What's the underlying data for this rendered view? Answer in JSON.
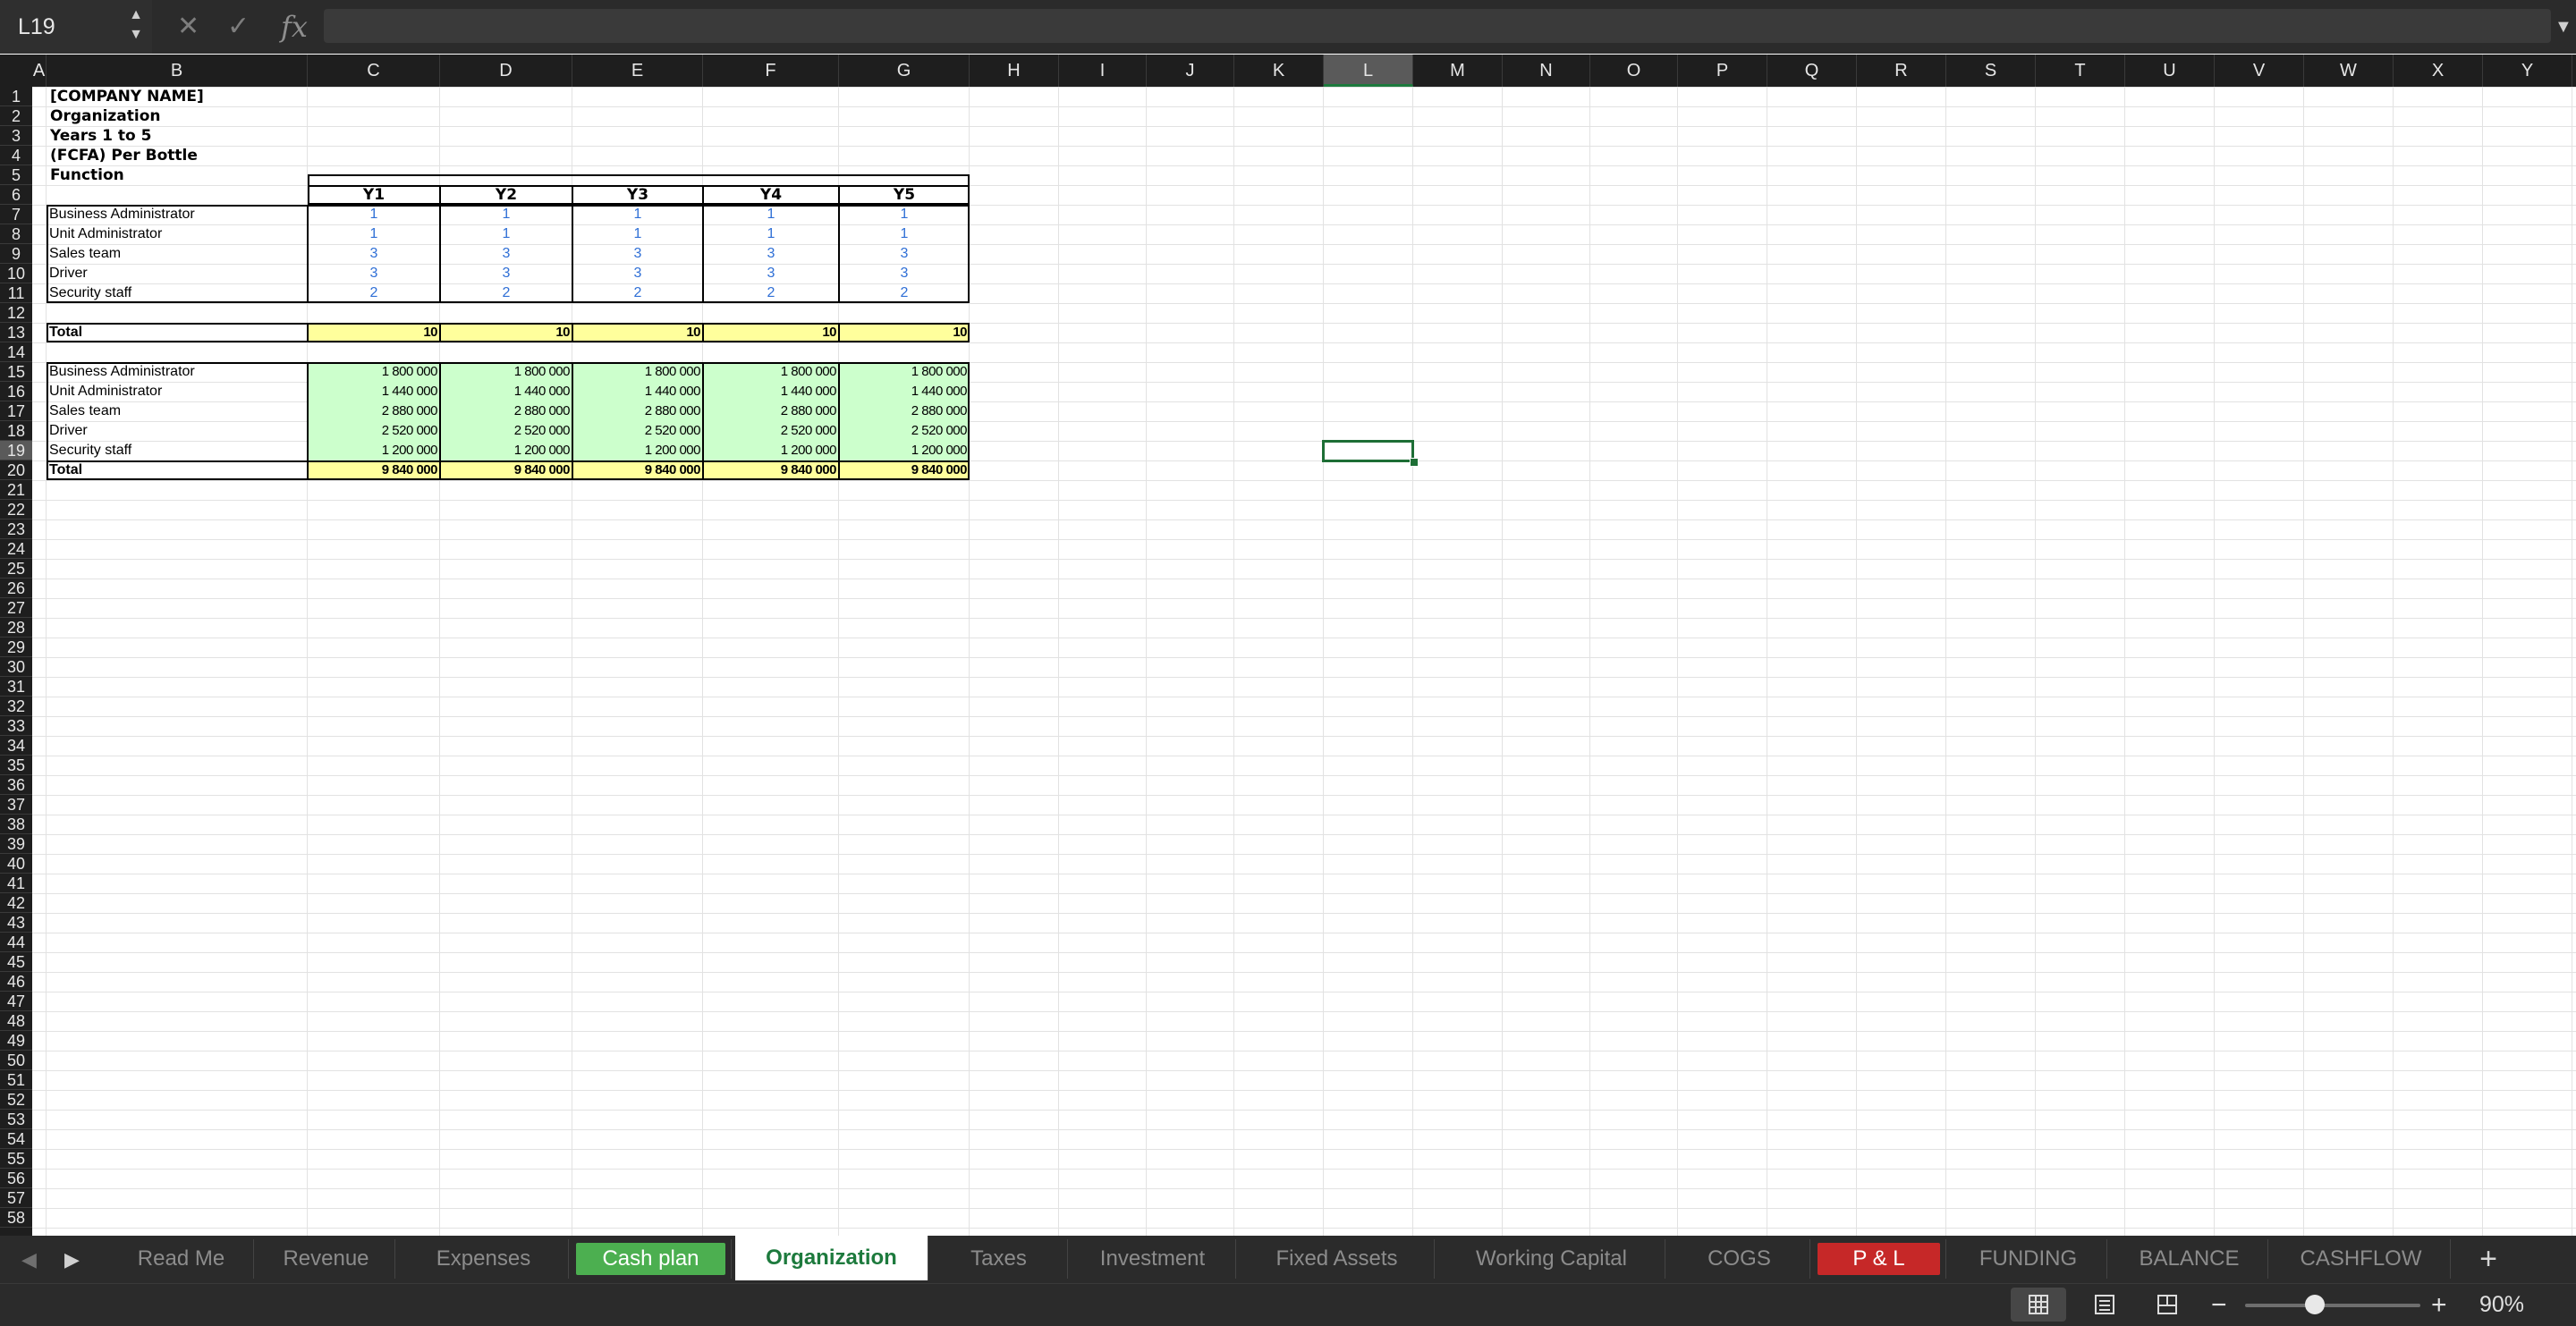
{
  "formula_bar": {
    "name_box": "L19",
    "formula": "",
    "cancel_glyph": "✕",
    "confirm_glyph": "✓",
    "fx_label": "fx"
  },
  "columns": [
    "A",
    "B",
    "C",
    "D",
    "E",
    "F",
    "G",
    "H",
    "I",
    "J",
    "K",
    "L",
    "M",
    "N",
    "O",
    "P",
    "Q",
    "R",
    "S",
    "T",
    "U",
    "V",
    "W",
    "X",
    "Y"
  ],
  "rows": [
    "1",
    "2",
    "3",
    "4",
    "5",
    "6",
    "7",
    "8",
    "9",
    "10",
    "11",
    "12",
    "13",
    "14",
    "15",
    "16",
    "17",
    "18",
    "19",
    "20",
    "21",
    "22",
    "23",
    "24",
    "25",
    "26",
    "27",
    "28",
    "29",
    "30",
    "31",
    "32",
    "33",
    "34",
    "35",
    "36",
    "37",
    "38",
    "39",
    "40",
    "41",
    "42",
    "43",
    "44",
    "45",
    "46",
    "47",
    "48",
    "49",
    "50",
    "51",
    "52",
    "53",
    "54",
    "55",
    "56",
    "57",
    "58"
  ],
  "selected": {
    "column": "L",
    "row": "19"
  },
  "sheet": {
    "title_lines": [
      "[COMPANY NAME]",
      "Organization",
      "Years 1 to 5",
      "(FCFA) Per Bottle",
      "Function"
    ],
    "years": [
      "Y1",
      "Y2",
      "Y3",
      "Y4",
      "Y5"
    ],
    "headcount": [
      {
        "label": "Business Administrator",
        "values": [
          "1",
          "1",
          "1",
          "1",
          "1"
        ]
      },
      {
        "label": "Unit Administrator",
        "values": [
          "1",
          "1",
          "1",
          "1",
          "1"
        ]
      },
      {
        "label": "Sales team",
        "values": [
          "3",
          "3",
          "3",
          "3",
          "3"
        ]
      },
      {
        "label": "Driver",
        "values": [
          "3",
          "3",
          "3",
          "3",
          "3"
        ]
      },
      {
        "label": "Security staff",
        "values": [
          "2",
          "2",
          "2",
          "2",
          "2"
        ]
      }
    ],
    "headcount_total": {
      "label": "Total",
      "values": [
        "10",
        "10",
        "10",
        "10",
        "10"
      ]
    },
    "salaries": [
      {
        "label": "Business Administrator",
        "values": [
          "1 800 000",
          "1 800 000",
          "1 800 000",
          "1 800 000",
          "1 800 000"
        ]
      },
      {
        "label": "Unit Administrator",
        "values": [
          "1 440 000",
          "1 440 000",
          "1 440 000",
          "1 440 000",
          "1 440 000"
        ]
      },
      {
        "label": "Sales team",
        "values": [
          "2 880 000",
          "2 880 000",
          "2 880 000",
          "2 880 000",
          "2 880 000"
        ]
      },
      {
        "label": "Driver",
        "values": [
          "2 520 000",
          "2 520 000",
          "2 520 000",
          "2 520 000",
          "2 520 000"
        ]
      },
      {
        "label": "Security staff",
        "values": [
          "1 200 000",
          "1 200 000",
          "1 200 000",
          "1 200 000",
          "1 200 000"
        ]
      }
    ],
    "salaries_total": {
      "label": "Total",
      "values": [
        "9 840 000",
        "9 840 000",
        "9 840 000",
        "9 840 000",
        "9 840 000"
      ]
    }
  },
  "tabs": [
    {
      "label": "Read Me"
    },
    {
      "label": "Revenue"
    },
    {
      "label": "Expenses"
    },
    {
      "label": "Cash plan",
      "color": "#4caf50"
    },
    {
      "label": "Organization",
      "active": true
    },
    {
      "label": "Taxes"
    },
    {
      "label": "Investment"
    },
    {
      "label": "Fixed Assets"
    },
    {
      "label": "Working Capital"
    },
    {
      "label": "COGS"
    },
    {
      "label": "P & L",
      "color": "#c62828"
    },
    {
      "label": "FUNDING"
    },
    {
      "label": "BALANCE"
    },
    {
      "label": "CASHFLOW"
    }
  ],
  "add_sheet_label": "+",
  "status": {
    "zoom_minus": "−",
    "zoom_plus": "+",
    "zoom_level": "90%",
    "zoom_fraction": 0.4
  },
  "colors": {
    "accent": "#1d7a3d",
    "total_fill": "#ffff9c",
    "salary_fill": "#ccffcc",
    "input_blue": "#2f6fd6"
  }
}
